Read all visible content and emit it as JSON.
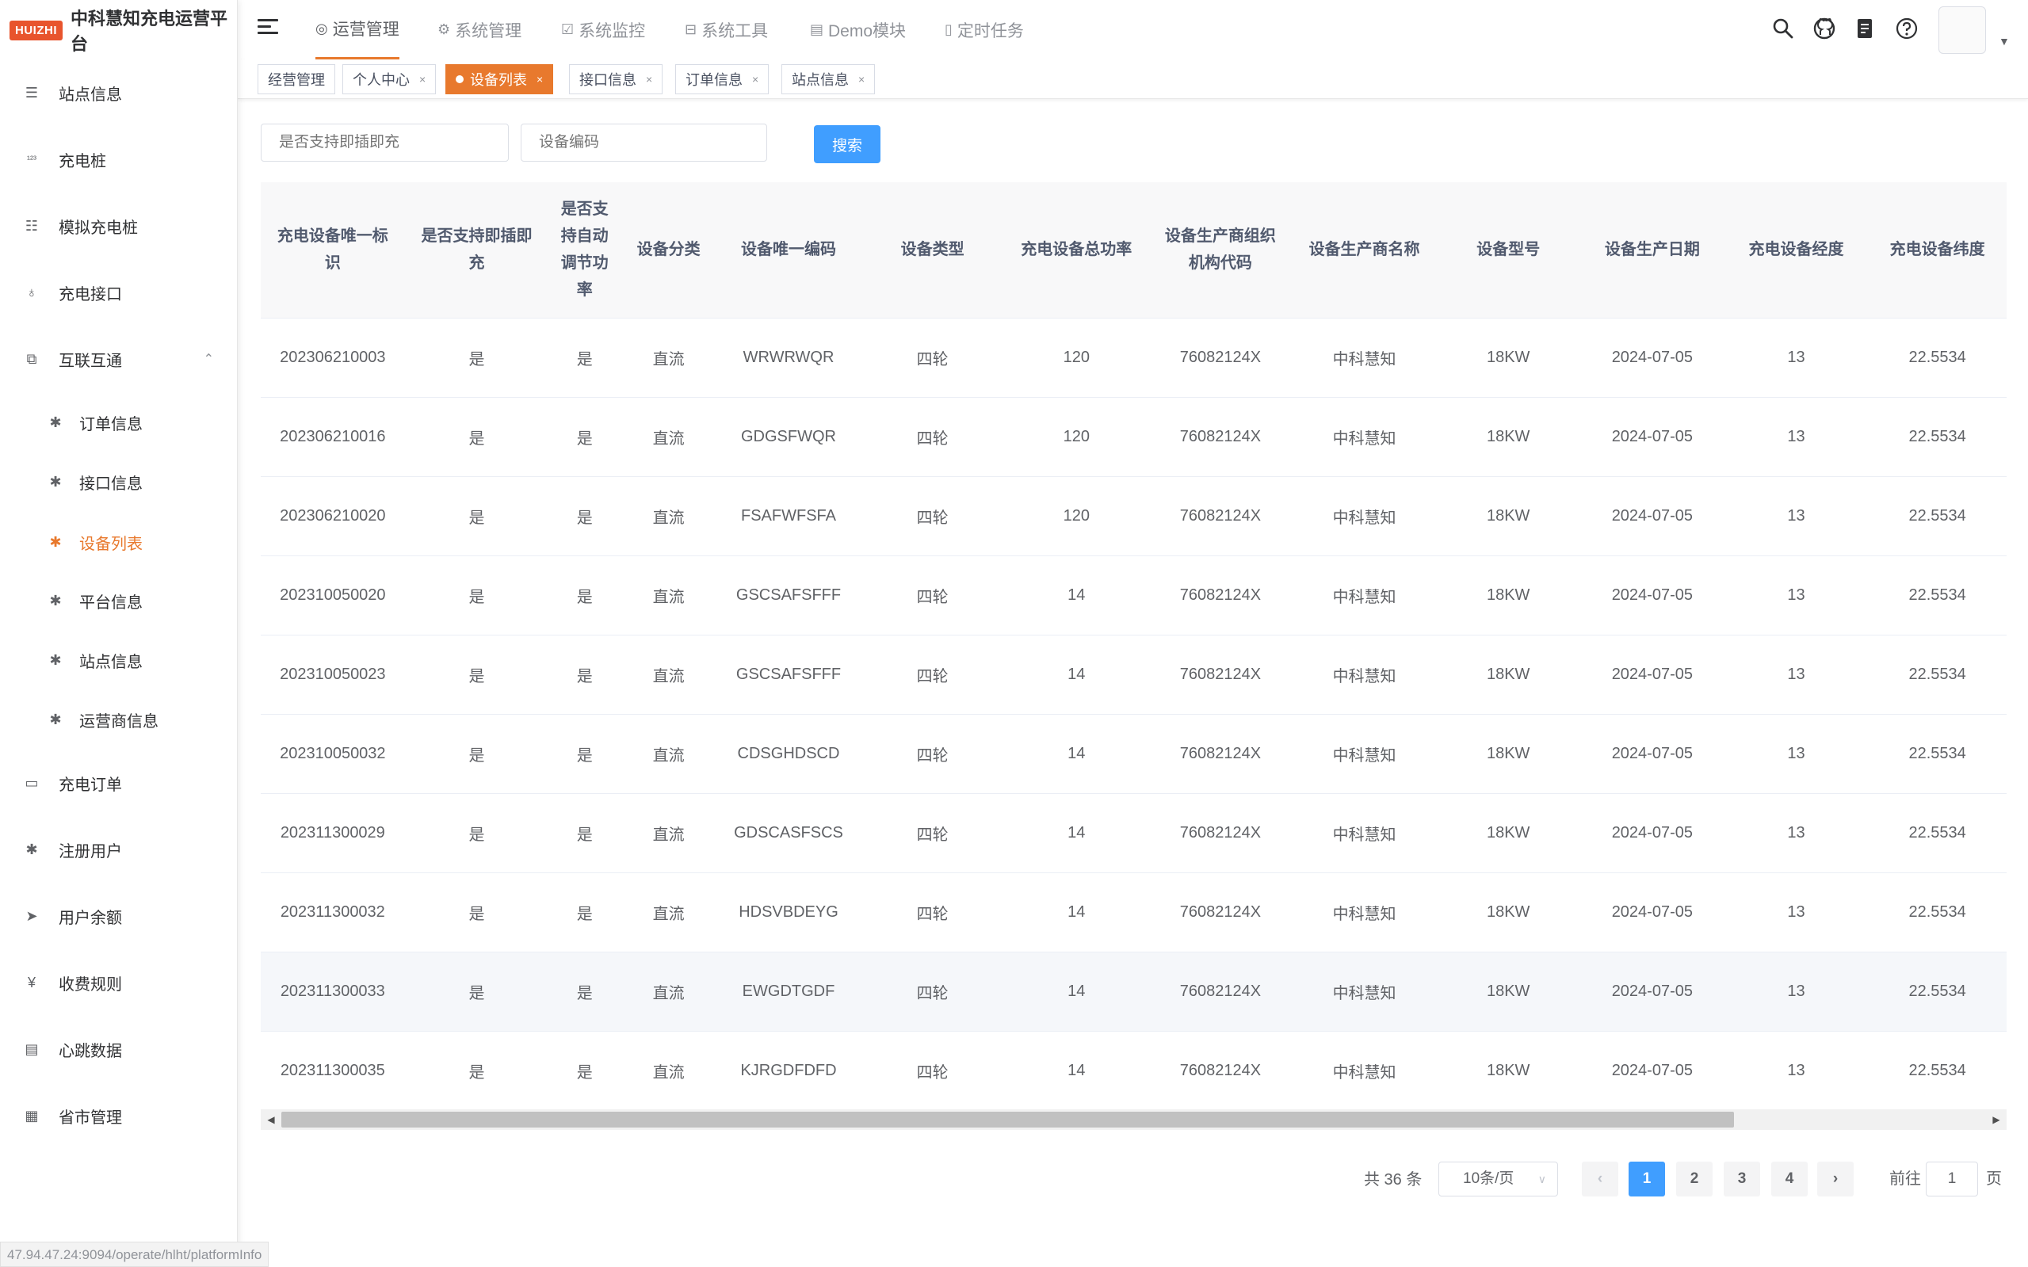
{
  "app": {
    "logo_badge": "HUIZHI",
    "title": "中科慧知充电运营平台"
  },
  "sidebar": {
    "items": [
      {
        "label": "站点信息",
        "icon": "list-icon"
      },
      {
        "label": "充电桩",
        "icon": "number-icon"
      },
      {
        "label": "模拟充电桩",
        "icon": "tree-list-icon"
      },
      {
        "label": "充电接口",
        "icon": "plug-icon"
      },
      {
        "label": "互联互通",
        "icon": "puzzle-icon",
        "expanded": true
      },
      {
        "label": "订单信息",
        "icon": "bug-icon",
        "sub": true
      },
      {
        "label": "接口信息",
        "icon": "bug-icon",
        "sub": true
      },
      {
        "label": "设备列表",
        "icon": "bug-icon",
        "sub": true,
        "active": true
      },
      {
        "label": "平台信息",
        "icon": "bug-icon",
        "sub": true
      },
      {
        "label": "站点信息",
        "icon": "bug-icon",
        "sub": true
      },
      {
        "label": "运营商信息",
        "icon": "bug-icon",
        "sub": true
      },
      {
        "label": "充电订单",
        "icon": "monitor-icon"
      },
      {
        "label": "注册用户",
        "icon": "bug-icon"
      },
      {
        "label": "用户余额",
        "icon": "send-icon"
      },
      {
        "label": "收费规则",
        "icon": "yen-icon"
      },
      {
        "label": "心跳数据",
        "icon": "card-icon"
      },
      {
        "label": "省市管理",
        "icon": "sheet-icon"
      }
    ],
    "chevron": "⌃"
  },
  "status_url": "47.94.47.24:9094/operate/hlht/platformInfo",
  "topnav": {
    "tabs": [
      {
        "label": "运营管理",
        "icon": "◎",
        "active": true
      },
      {
        "label": "系统管理",
        "icon": "⚙"
      },
      {
        "label": "系统监控",
        "icon": "☑"
      },
      {
        "label": "系统工具",
        "icon": "⊟"
      },
      {
        "label": "Demo模块",
        "icon": "▤"
      },
      {
        "label": "定时任务",
        "icon": "▯"
      }
    ]
  },
  "tags": [
    {
      "label": "经营管理",
      "closable": false
    },
    {
      "label": "个人中心",
      "closable": true
    },
    {
      "label": "设备列表",
      "closable": true,
      "active": true
    },
    {
      "label": "接口信息",
      "closable": true
    },
    {
      "label": "订单信息",
      "closable": true
    },
    {
      "label": "站点信息",
      "closable": true
    }
  ],
  "filters": {
    "plug_placeholder": "是否支持即插即充",
    "code_placeholder": "设备编码",
    "search_label": "搜索"
  },
  "table": {
    "columns": [
      "充电设备唯一标识",
      "是否支持即插即充",
      "是否支持自动调节功率",
      "设备分类",
      "设备唯一编码",
      "设备类型",
      "充电设备总功率",
      "设备生产商组织机构代码",
      "设备生产商名称",
      "设备型号",
      "设备生产日期",
      "充电设备经度",
      "充电设备纬度"
    ],
    "rows": [
      [
        "202306210003",
        "是",
        "是",
        "直流",
        "WRWRWQR",
        "四轮",
        "120",
        "76082124X",
        "中科慧知",
        "18KW",
        "2024-07-05",
        "13",
        "22.5534"
      ],
      [
        "202306210016",
        "是",
        "是",
        "直流",
        "GDGSFWQR",
        "四轮",
        "120",
        "76082124X",
        "中科慧知",
        "18KW",
        "2024-07-05",
        "13",
        "22.5534"
      ],
      [
        "202306210020",
        "是",
        "是",
        "直流",
        "FSAFWFSFA",
        "四轮",
        "120",
        "76082124X",
        "中科慧知",
        "18KW",
        "2024-07-05",
        "13",
        "22.5534"
      ],
      [
        "202310050020",
        "是",
        "是",
        "直流",
        "GSCSAFSFFF",
        "四轮",
        "14",
        "76082124X",
        "中科慧知",
        "18KW",
        "2024-07-05",
        "13",
        "22.5534"
      ],
      [
        "202310050023",
        "是",
        "是",
        "直流",
        "GSCSAFSFFF",
        "四轮",
        "14",
        "76082124X",
        "中科慧知",
        "18KW",
        "2024-07-05",
        "13",
        "22.5534"
      ],
      [
        "202310050032",
        "是",
        "是",
        "直流",
        "CDSGHDSCD",
        "四轮",
        "14",
        "76082124X",
        "中科慧知",
        "18KW",
        "2024-07-05",
        "13",
        "22.5534"
      ],
      [
        "202311300029",
        "是",
        "是",
        "直流",
        "GDSCASFSCS",
        "四轮",
        "14",
        "76082124X",
        "中科慧知",
        "18KW",
        "2024-07-05",
        "13",
        "22.5534"
      ],
      [
        "202311300032",
        "是",
        "是",
        "直流",
        "HDSVBDEYG",
        "四轮",
        "14",
        "76082124X",
        "中科慧知",
        "18KW",
        "2024-07-05",
        "13",
        "22.5534"
      ],
      [
        "202311300033",
        "是",
        "是",
        "直流",
        "EWGDTGDF",
        "四轮",
        "14",
        "76082124X",
        "中科慧知",
        "18KW",
        "2024-07-05",
        "13",
        "22.5534"
      ],
      [
        "202311300035",
        "是",
        "是",
        "直流",
        "KJRGDFDFD",
        "四轮",
        "14",
        "76082124X",
        "中科慧知",
        "18KW",
        "2024-07-05",
        "13",
        "22.5534"
      ]
    ],
    "hover_row_index": 8
  },
  "pagination": {
    "total": "共 36 条",
    "page_size": "10条/页",
    "pages": [
      "1",
      "2",
      "3",
      "4"
    ],
    "current": "1",
    "prev": "‹",
    "next": "›",
    "goto_prefix": "前往",
    "goto_value": "1",
    "goto_suffix": "页"
  },
  "colors": {
    "accent": "#e8792d",
    "primary": "#409eff",
    "logo": "#e8542d"
  }
}
